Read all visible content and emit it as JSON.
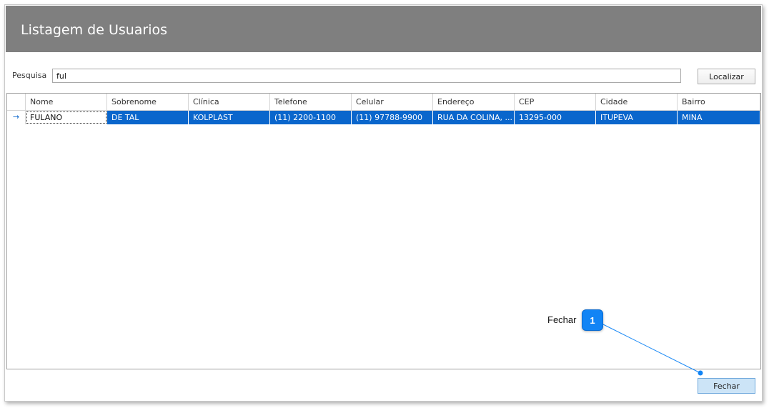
{
  "window": {
    "title": "Listagem de Usuarios"
  },
  "search": {
    "label": "Pesquisa",
    "value": "ful",
    "button_label": "Localizar"
  },
  "grid": {
    "row_indicator": "→",
    "columns": [
      "Nome",
      "Sobrenome",
      "Clínica",
      "Telefone",
      "Celular",
      "Endereço",
      "CEP",
      "Cidade",
      "Bairro"
    ],
    "rows": [
      [
        "FULANO",
        "DE TAL",
        "KOLPLAST",
        "(11) 2200-1100",
        "(11) 97788-9900",
        "RUA DA COLINA, ...",
        "13295-000",
        "ITUPEVA",
        "MINA"
      ]
    ]
  },
  "footer": {
    "close_label": "Fechar"
  },
  "callout": {
    "number": "1",
    "label": "Fechar"
  },
  "colors": {
    "header_bg": "#7f7f7f",
    "selection": "#0a66cc",
    "callout": "#1184f5"
  }
}
